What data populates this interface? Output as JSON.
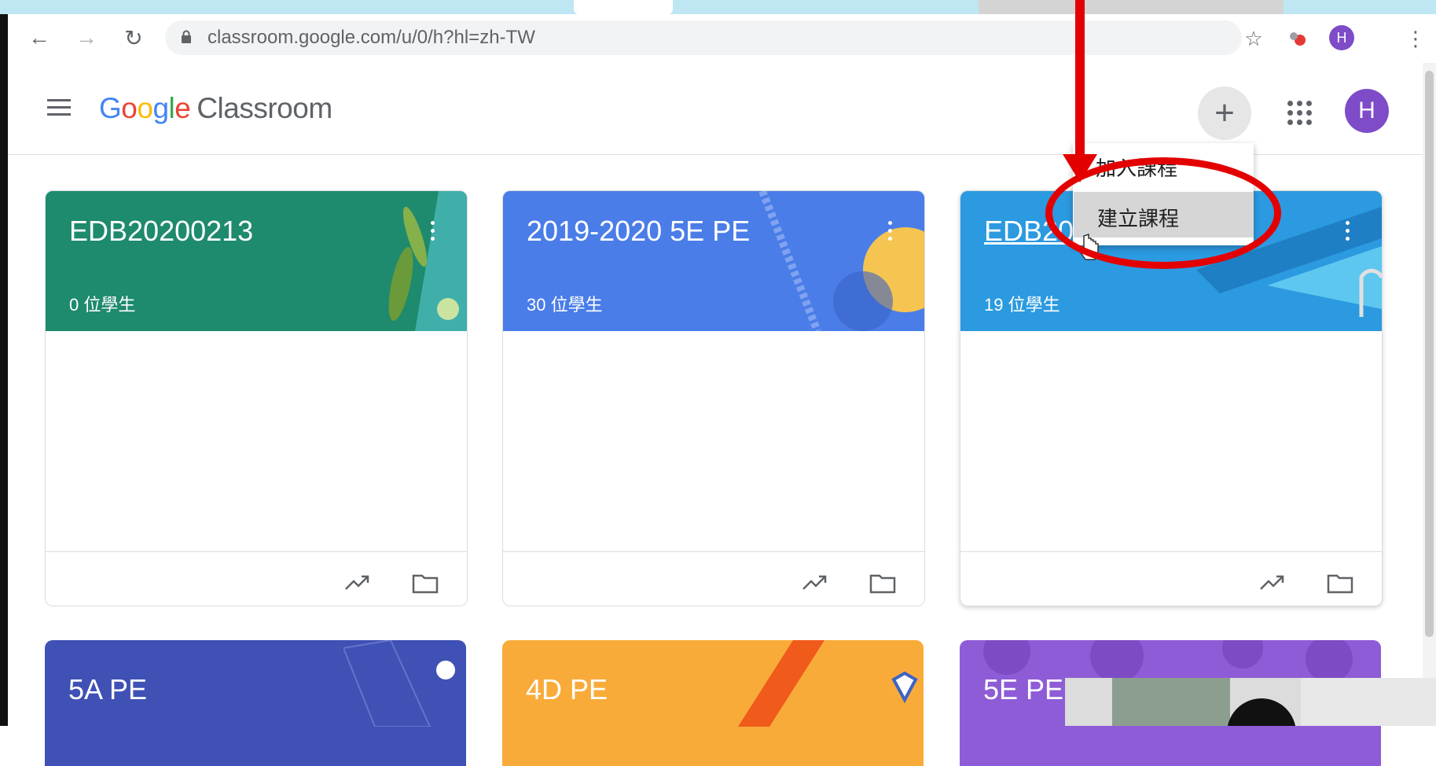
{
  "browser": {
    "url": "classroom.google.com/u/0/h?hl=zh-TW",
    "profile_initial": "H"
  },
  "app": {
    "logo_google": [
      "G",
      "o",
      "o",
      "g",
      "l",
      "e"
    ],
    "logo_product": "Classroom",
    "avatar_initial": "H"
  },
  "menu": {
    "join_label": "加入課程",
    "create_label": "建立課程"
  },
  "courses": [
    {
      "title": "EDB20200213",
      "students": "0 位學生",
      "color": "#1e8a6e"
    },
    {
      "title": "2019-2020 5E PE",
      "students": "30 位學生",
      "color": "#4a7de8"
    },
    {
      "title": "EDB20",
      "students": "19 位學生",
      "color": "#2b9ae0"
    },
    {
      "title": "5A PE",
      "color": "#3f51b5"
    },
    {
      "title": "4D PE",
      "color": "#f9ab3a"
    },
    {
      "title": "5E PE",
      "color": "#8e5cd6"
    }
  ]
}
